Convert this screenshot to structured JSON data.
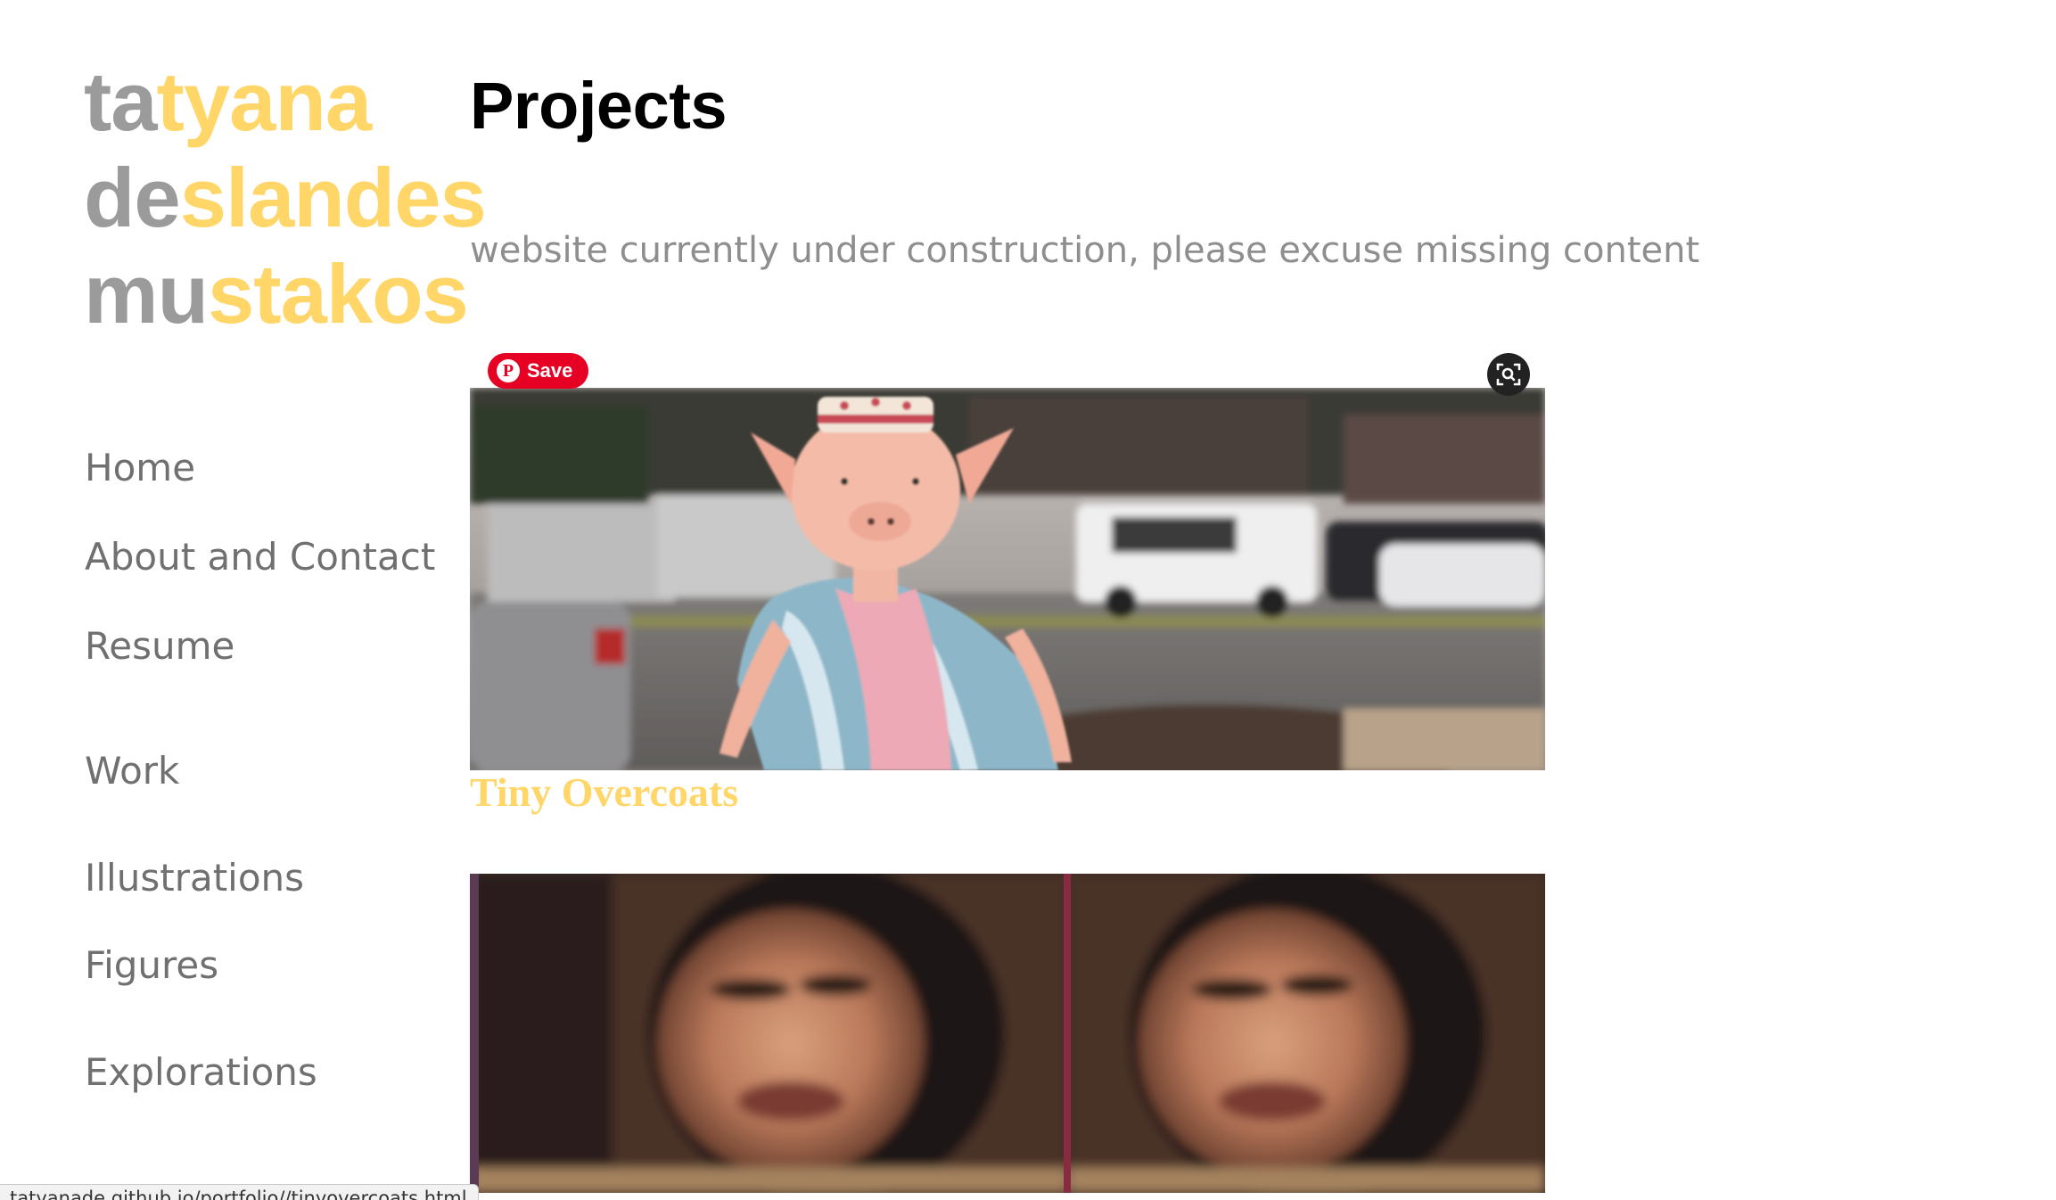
{
  "logo": {
    "line1_grey": "ta",
    "line1_yellow": "tyana",
    "line2_grey": "de",
    "line2_yellow": "slandes",
    "line3_grey": "mu",
    "line3_yellow": "stakos"
  },
  "nav": {
    "items": [
      {
        "label": "Home"
      },
      {
        "label": "About and Contact"
      },
      {
        "label": "Resume"
      },
      {
        "label": "Work"
      },
      {
        "label": "Illustrations"
      },
      {
        "label": "Figures"
      },
      {
        "label": "Explorations"
      }
    ]
  },
  "main": {
    "title": "Projects",
    "notice": "website currently under construction, please excuse missing content",
    "projects": [
      {
        "title": "Tiny Overcoats",
        "image": "pig-doll-photo"
      },
      {
        "title": "",
        "image": "distorted-portrait-photo"
      }
    ]
  },
  "overlay": {
    "pinterest_save_label": "Save",
    "pinterest_icon": "pinterest-icon",
    "visual_search_icon": "visual-search-icon"
  },
  "status_bar": {
    "url": "tatyanade.github.io/portfolio//tinyovercoats.html"
  },
  "colors": {
    "logo_grey": "#9b9b9b",
    "accent_yellow": "#ffd667",
    "nav_text": "#707070",
    "pinterest_red": "#e60023"
  }
}
